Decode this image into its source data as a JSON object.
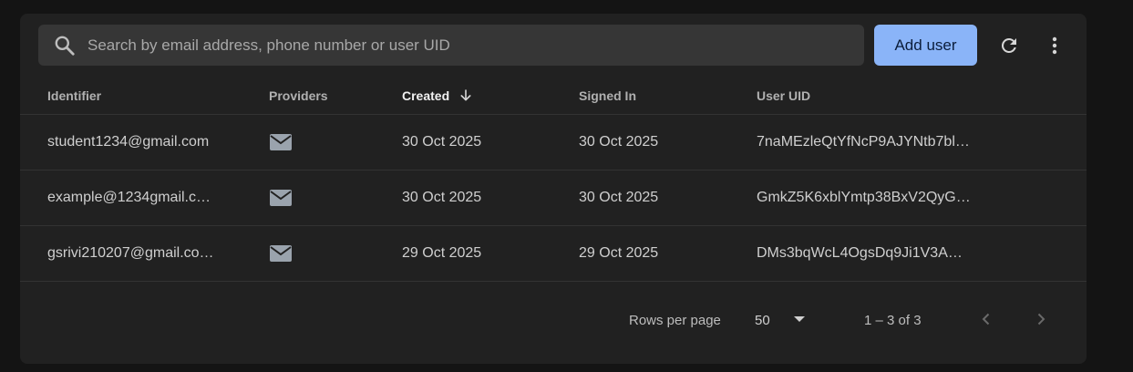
{
  "search": {
    "placeholder": "Search by email address, phone number or user UID",
    "value": ""
  },
  "toolbar": {
    "add_user_label": "Add user",
    "refresh_icon": "refresh-icon",
    "more_icon": "more-vert-icon"
  },
  "columns": {
    "identifier": "Identifier",
    "providers": "Providers",
    "created": "Created",
    "signed_in": "Signed In",
    "user_uid": "User UID"
  },
  "rows": [
    {
      "identifier": "student1234@gmail.com",
      "provider_icon": "email-icon",
      "created": "30 Oct 2025",
      "signed_in": "30 Oct 2025",
      "uid": "7naMEzleQtYfNcP9AJYNtb7bl…"
    },
    {
      "identifier": "example@1234gmail.c…",
      "provider_icon": "email-icon",
      "created": "30 Oct 2025",
      "signed_in": "30 Oct 2025",
      "uid": "GmkZ5K6xblYmtp38BxV2QyG…"
    },
    {
      "identifier": "gsrivi210207@gmail.co…",
      "provider_icon": "email-icon",
      "created": "29 Oct 2025",
      "signed_in": "29 Oct 2025",
      "uid": "DMs3bqWcL4OgsDq9Ji1V3A…"
    }
  ],
  "pagination": {
    "rows_per_page_label": "Rows per page",
    "rows_per_page_value": "50",
    "range_text": "1 – 3 of 3"
  },
  "colors": {
    "accent": "#8ab4f8",
    "background": "#212121"
  }
}
